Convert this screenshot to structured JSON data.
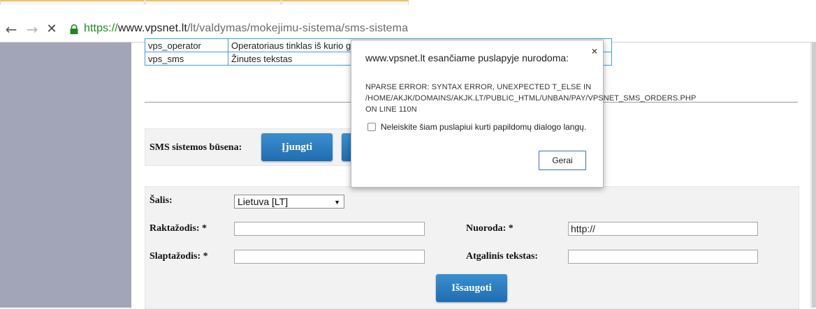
{
  "browser": {
    "url_scheme": "https://",
    "url_host": "www.vpsnet.lt",
    "url_path": "/lt/valdymas/mokejimu-sistema/sms-sistema"
  },
  "param_table": {
    "rows": [
      {
        "name": "vps_operator",
        "desc": "Operatoriaus tinklas iš kurio g"
      },
      {
        "name": "vps_sms",
        "desc": "Žinutes tekstas"
      }
    ]
  },
  "status": {
    "label": "SMS sistemos būsena:",
    "on_button": "Įjungti"
  },
  "form": {
    "country_label": "Šalis:",
    "country_value": "Lietuva [LT]",
    "keyword_label": "Raktažodis: *",
    "password_label": "Slaptažodis: *",
    "link_label": "Nuoroda: *",
    "link_value": "http://",
    "reply_label": "Atgalinis tekstas:",
    "save_button": "Išsaugoti"
  },
  "dialog": {
    "title": "www.vpsnet.lt esančiame puslapyje nurodoma:",
    "message": "NPARSE ERROR: SYNTAX ERROR, UNEXPECTED T_ELSE IN /HOME/AKJK/DOMAINS/AKJK.LT/PUBLIC_HTML/UNBAN/PAY/VPSNET_SMS_ORDERS.PHP ON LINE 110N",
    "checkbox_label": "Neleiskite šiam puslapiui kurti papildomų dialogo langų.",
    "ok_button": "Gerai",
    "close_glyph": "×"
  }
}
